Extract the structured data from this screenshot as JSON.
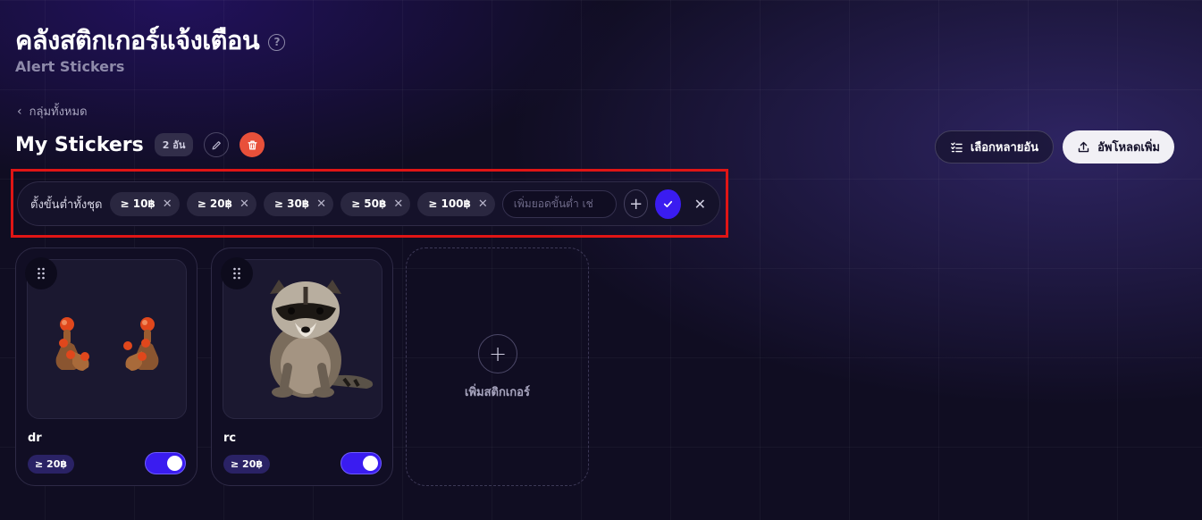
{
  "header": {
    "title": "คลังสติกเกอร์แจ้งเตือน",
    "subtitle": "Alert Stickers",
    "help_icon": "question-circle-icon"
  },
  "breadcrumb": {
    "back_label": "กลุ่มทั้งหมด"
  },
  "group": {
    "title": "My Stickers",
    "count": "2 อัน"
  },
  "actions": {
    "multi_select_label": "เลือกหลายอัน",
    "upload_label": "อัพโหลดเพิ่ม"
  },
  "threshold": {
    "label": "ตั้งขั้นต่ำทั้งชุด",
    "chips": [
      "≥ 10฿",
      "≥ 20฿",
      "≥ 30฿",
      "≥ 50฿",
      "≥ 100฿"
    ],
    "input_placeholder": "เพิ่มยอดขั้นต่ำ เช่",
    "input_value": ""
  },
  "stickers": [
    {
      "name": "dr",
      "min": "≥ 20฿",
      "enabled": true,
      "image": "robot-hands-sticker"
    },
    {
      "name": "rc",
      "min": "≥ 20฿",
      "enabled": true,
      "image": "raccoon-sticker"
    }
  ],
  "add_card": {
    "label": "เพิ่มสติกเกอร์"
  },
  "colors": {
    "accent": "#3a1cf0",
    "danger": "#e8503a",
    "highlight": "#e01515",
    "background": "#100d22"
  }
}
